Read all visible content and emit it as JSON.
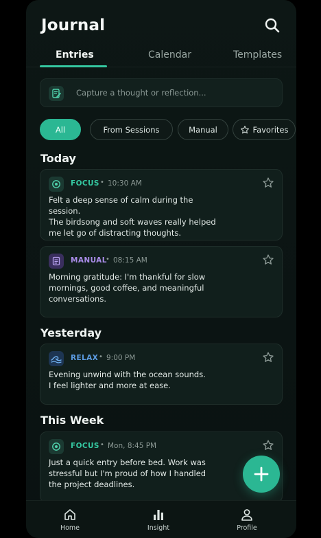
{
  "header": {
    "title": "Journal",
    "search_icon": "search-icon"
  },
  "tabs": [
    {
      "label": "Entries",
      "active": true
    },
    {
      "label": "Calendar",
      "active": false
    },
    {
      "label": "Templates",
      "active": false
    }
  ],
  "capture": {
    "placeholder": "Capture a thought or reflection...",
    "icon": "note-edit-icon"
  },
  "filters": [
    {
      "label": "All",
      "active": true
    },
    {
      "label": "From Sessions",
      "active": false
    },
    {
      "label": "Manual",
      "active": false
    },
    {
      "label": "Favorites",
      "active": false,
      "icon": "star-outline-icon"
    }
  ],
  "sections": [
    {
      "title": "Today",
      "entries": [
        {
          "tag": "FOCUS",
          "tag_color": "#35c8a1",
          "icon": "target-icon",
          "time": "10:30 AM",
          "lines": [
            "Felt a deep sense of calm during the session.",
            "The birdsong and soft waves really helped",
            "me let go of distracting thoughts."
          ]
        },
        {
          "tag": "MANUAL",
          "tag_color": "#a98ce8",
          "icon": "document-icon",
          "time": "08:15 AM",
          "lines": [
            "Morning gratitude: I'm thankful for slow",
            "mornings, good coffee, and meaningful",
            "conversations."
          ]
        }
      ]
    },
    {
      "title": "Yesterday",
      "entries": [
        {
          "tag": "RELAX",
          "tag_color": "#5b9ae0",
          "icon": "wave-icon",
          "time": "9:00 PM",
          "lines": [
            "Evening unwind with the ocean sounds.",
            "I feel lighter and more at ease."
          ]
        }
      ]
    },
    {
      "title": "This Week",
      "entries": [
        {
          "tag": "FOCUS",
          "tag_color": "#35c8a1",
          "icon": "target-icon",
          "time": "Mon, 8:45 PM",
          "lines": [
            "Just a quick entry before bed. Work was",
            "stressful but I'm proud of how I handled",
            "the project deadlines."
          ]
        }
      ]
    }
  ],
  "fab": {
    "icon": "plus-icon"
  },
  "bottom_nav": [
    {
      "label": "Home",
      "icon": "home-icon"
    },
    {
      "label": "Insight",
      "icon": "bar-chart-icon"
    },
    {
      "label": "Profile",
      "icon": "person-icon"
    }
  ],
  "colors": {
    "accent": "#2bb793",
    "background": "#0b1413",
    "card": "#111f1c"
  }
}
